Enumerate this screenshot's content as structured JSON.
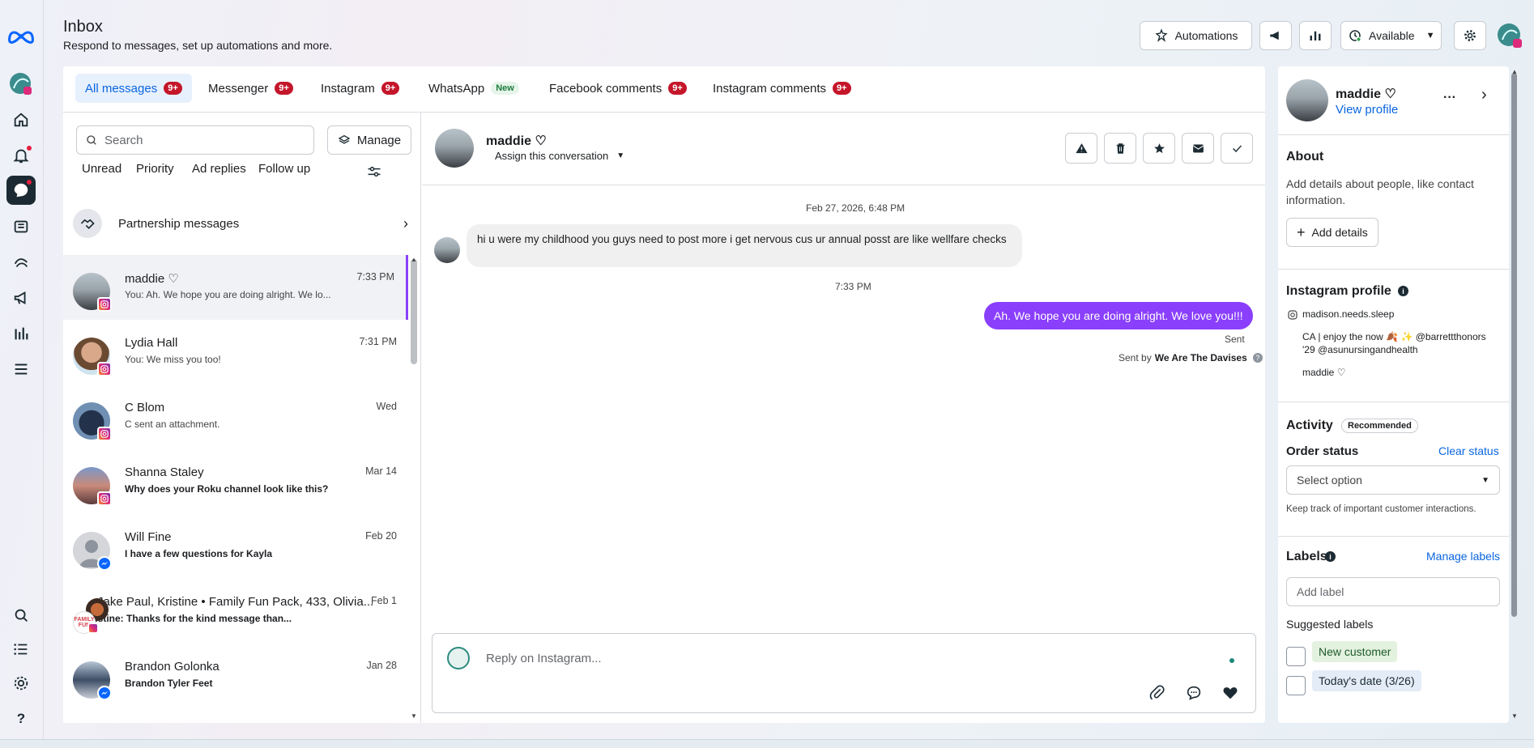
{
  "header": {
    "title": "Inbox",
    "subtitle": "Respond to messages, set up automations and more.",
    "automations_label": "Automations",
    "status_label": "Available"
  },
  "tabs": [
    {
      "label": "All messages",
      "badge": "9+"
    },
    {
      "label": "Messenger",
      "badge": "9+"
    },
    {
      "label": "Instagram",
      "badge": "9+"
    },
    {
      "label": "WhatsApp",
      "badge": "New"
    },
    {
      "label": "Facebook comments",
      "badge": "9+"
    },
    {
      "label": "Instagram comments",
      "badge": "9+"
    }
  ],
  "list": {
    "search_placeholder": "Search",
    "manage_label": "Manage",
    "filters": [
      "Unread",
      "Priority",
      "Ad replies",
      "Follow up"
    ],
    "partnership_label": "Partnership messages",
    "conversations": [
      {
        "name": "maddie ♡",
        "message": "You: Ah. We hope you are doing alright. We lo...",
        "time": "7:33 PM",
        "platform": "instagram"
      },
      {
        "name": "Lydia Hall",
        "message": "You: We miss you too!",
        "time": "7:31 PM",
        "platform": "instagram"
      },
      {
        "name": "C Blom",
        "message": "C sent an attachment.",
        "time": "Wed",
        "platform": "instagram"
      },
      {
        "name": "Shanna Staley",
        "message": "Why does your Roku channel look like this?",
        "time": "Mar 14",
        "platform": "instagram"
      },
      {
        "name": "Will Fine",
        "message": "I have a few questions for Kayla",
        "time": "Feb 20",
        "platform": "messenger"
      },
      {
        "name": "Jake Paul, Kristine • Family Fun Pack, 433, Olivia...",
        "message": "Kristine: Thanks for the kind message than...",
        "time": "Feb 1",
        "platform": "instagram"
      },
      {
        "name": "Brandon Golonka",
        "message": "Brandon Tyler Feet",
        "time": "Jan 28",
        "platform": "messenger"
      }
    ]
  },
  "chat": {
    "contact_name": "maddie ♡",
    "assign_label": "Assign this conversation",
    "date_stamp": "Feb 27, 2026, 6:48 PM",
    "incoming_message": "hi u were my childhood you guys need to post more i get nervous cus ur annual posst are like wellfare checks",
    "time_stamp": "7:33 PM",
    "outgoing_message": "Ah. We hope you are doing alright. We love you!!!",
    "sent_status": "Sent",
    "sent_by_prefix": "Sent by",
    "sent_by_name": "We Are The Davises",
    "reply_placeholder": "Reply on Instagram..."
  },
  "profile": {
    "name": "maddie ♡",
    "view_profile": "View profile",
    "about_heading": "About",
    "about_text": "Add details about people, like contact information.",
    "add_details": "Add details",
    "ig_heading": "Instagram profile",
    "ig_handle": "madison.needs.sleep",
    "ig_bio_line1": "CA | enjoy the now 🍂 ✨ @barrettthonors",
    "ig_bio_line2": "'29 @asunursingandhealth",
    "ig_display_name": "maddie ♡",
    "activity_heading": "Activity",
    "activity_badge": "Recommended",
    "order_status_label": "Order status",
    "clear_status": "Clear status",
    "select_option": "Select option",
    "order_hint": "Keep track of important customer interactions.",
    "labels_heading": "Labels",
    "manage_labels": "Manage labels",
    "add_label_placeholder": "Add label",
    "suggested_heading": "Suggested labels",
    "suggested": [
      "New customer",
      "Today's date (3/26)"
    ]
  },
  "colors": {
    "accent": "#0a66e0",
    "outgoing_bubble": "#8a3ffc",
    "badge_red": "#c4162a"
  }
}
